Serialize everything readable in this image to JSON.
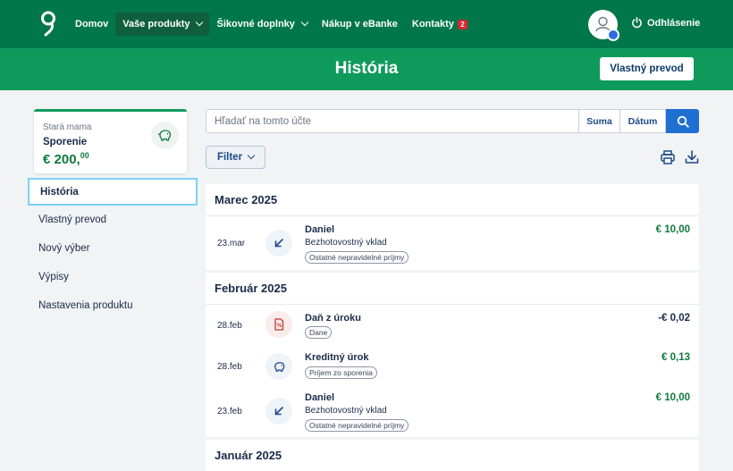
{
  "nav": {
    "items": [
      {
        "label": "Domov",
        "active": false,
        "dropdown": false
      },
      {
        "label": "Vaše produkty",
        "active": true,
        "dropdown": true
      },
      {
        "label": "Šikovné doplnky",
        "active": false,
        "dropdown": true
      },
      {
        "label": "Nákup v eBanke",
        "active": false,
        "dropdown": false
      },
      {
        "label": "Kontakty",
        "active": false,
        "dropdown": false,
        "badge": "2"
      }
    ],
    "logout_label": "Odhlásenie"
  },
  "header": {
    "title": "História",
    "action_label": "Vlastný prevod"
  },
  "account": {
    "owner": "Stará mama",
    "name": "Sporenie",
    "balance_main": "€ 200,",
    "balance_cents": "00",
    "icon": "piggy-bank-icon"
  },
  "sidebar": {
    "items": [
      {
        "label": "História",
        "active": true
      },
      {
        "label": "Vlastný prevod",
        "active": false
      },
      {
        "label": "Nový výber",
        "active": false
      },
      {
        "label": "Výpisy",
        "active": false
      },
      {
        "label": "Nastavenia produktu",
        "active": false
      }
    ]
  },
  "search": {
    "placeholder": "Hľadať na tomto účte",
    "sort_amount": "Suma",
    "sort_date": "Dátum"
  },
  "filter_label": "Filter",
  "months": [
    {
      "label": "Marec 2025",
      "transactions": [
        {
          "date": "23.mar",
          "name": "Daniel",
          "desc": "Bezhotovostný vklad",
          "tag": "Ostatné nepravidelné príjmy",
          "amount": "€ 10,00",
          "type": "pos",
          "icon": "incoming-arrow-icon"
        }
      ]
    },
    {
      "label": "Február 2025",
      "transactions": [
        {
          "date": "28.feb",
          "name": "Daň z úroku",
          "desc": "",
          "tag": "Dane",
          "amount": "-€ 0,02",
          "type": "neg",
          "icon": "tax-icon"
        },
        {
          "date": "28.feb",
          "name": "Kreditný úrok",
          "desc": "",
          "tag": "Príjem zo sporenia",
          "amount": "€ 0,13",
          "type": "pos",
          "icon": "piggy-bank-icon"
        },
        {
          "date": "23.feb",
          "name": "Daniel",
          "desc": "Bezhotovostný vklad",
          "tag": "Ostatné nepravidelné príjmy",
          "amount": "€ 10,00",
          "type": "pos",
          "icon": "incoming-arrow-icon"
        }
      ]
    },
    {
      "label": "Január 2025",
      "transactions": []
    }
  ],
  "colors": {
    "nav": "#00774a",
    "banner": "#0f9a5c",
    "positive": "#0f7a3a",
    "primary": "#1f6fd1"
  }
}
